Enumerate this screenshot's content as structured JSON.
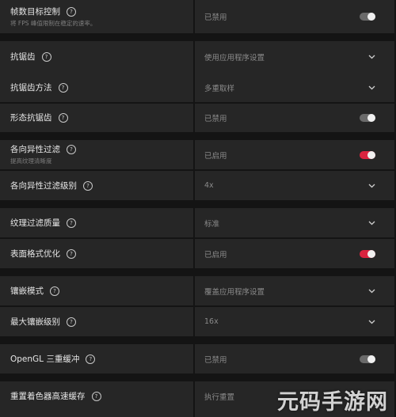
{
  "settings": {
    "frame_target": {
      "label": "帧数目标控制",
      "desc": "将 FPS 峰值限制在稳定的速率。",
      "value": "已禁用",
      "control": "toggle",
      "state": "off"
    },
    "anti_aliasing": {
      "label": "抗锯齿",
      "value": "使用应用程序设置",
      "control": "dropdown"
    },
    "aa_method": {
      "label": "抗锯齿方法",
      "value": "多重取样",
      "control": "dropdown"
    },
    "morph_aa": {
      "label": "形态抗锯齿",
      "value": "已禁用",
      "control": "toggle",
      "state": "off"
    },
    "anisotropic": {
      "label": "各向异性过滤",
      "desc": "提高纹理清晰度",
      "value": "已启用",
      "control": "toggle",
      "state": "on"
    },
    "anisotropic_level": {
      "label": "各向异性过滤级别",
      "value": "4x",
      "control": "dropdown"
    },
    "texture_quality": {
      "label": "纹理过滤质量",
      "value": "标准",
      "control": "dropdown"
    },
    "surface_format": {
      "label": "表面格式优化",
      "value": "已启用",
      "control": "toggle",
      "state": "on"
    },
    "tessellation_mode": {
      "label": "镶嵌模式",
      "value": "覆盖应用程序设置",
      "control": "dropdown"
    },
    "max_tessellation": {
      "label": "最大镶嵌级别",
      "value": "16x",
      "control": "dropdown"
    },
    "opengl_triple": {
      "label": "OpenGL 三重缓冲",
      "value": "已禁用",
      "control": "toggle",
      "state": "off"
    },
    "reset_shader": {
      "label": "重置着色器高速缓存",
      "value": "执行重置",
      "control": "action"
    }
  },
  "help_glyph": "?",
  "colors": {
    "toggle_on": "#d9233f",
    "toggle_off": "#6a6a6a",
    "panel": "#262626",
    "background": "#141414"
  },
  "icons": {
    "help": "question-circle-icon",
    "dropdown": "chevron-down-icon"
  },
  "watermark": "元码手游网"
}
